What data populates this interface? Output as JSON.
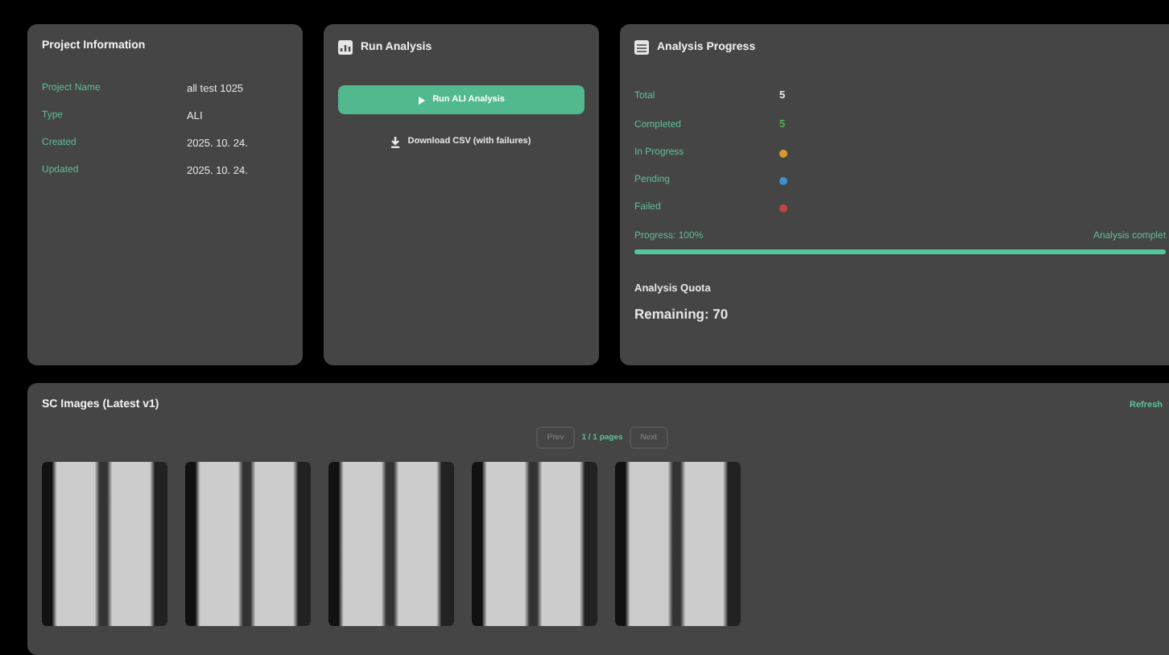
{
  "project_info": {
    "title": "Project Information",
    "fields": [
      {
        "label": "Project Name",
        "value": "all test 1025"
      },
      {
        "label": "Type",
        "value": "ALI"
      },
      {
        "label": "Created",
        "value": "2025. 10. 24."
      },
      {
        "label": "Updated",
        "value": "2025. 10. 24."
      }
    ]
  },
  "run_analysis": {
    "title": "Run Analysis",
    "run_button": "Run ALI Analysis",
    "download_button": "Download CSV (with failures)"
  },
  "analysis_progress": {
    "title": "Analysis Progress",
    "stats": [
      {
        "label": "Total",
        "kind": "count",
        "value": "5",
        "color": "#e8e8e8"
      },
      {
        "label": "Completed",
        "kind": "count",
        "value": "5",
        "color": "#4caf50"
      },
      {
        "label": "In Progress",
        "kind": "dot",
        "color": "#d9982e"
      },
      {
        "label": "Pending",
        "kind": "dot",
        "color": "#3b8fd0"
      },
      {
        "label": "Failed",
        "kind": "dot",
        "color": "#c0453a"
      }
    ],
    "progress_label": "Progress: 100%",
    "status": "Analysis complet",
    "level": 1,
    "quota_title": "Analysis Quota",
    "quota_remaining": "Remaining: 70"
  },
  "images": {
    "title": "SC Images (Latest v1)",
    "refresh": "Refresh",
    "prev": "Prev",
    "page": "1 / 1 pages",
    "next": "Next",
    "thumbnails": [
      {
        "kind": "photo"
      },
      {
        "kind": "photo"
      },
      {
        "kind": "photo"
      },
      {
        "kind": "photo"
      },
      {
        "kind": "photo"
      }
    ]
  }
}
